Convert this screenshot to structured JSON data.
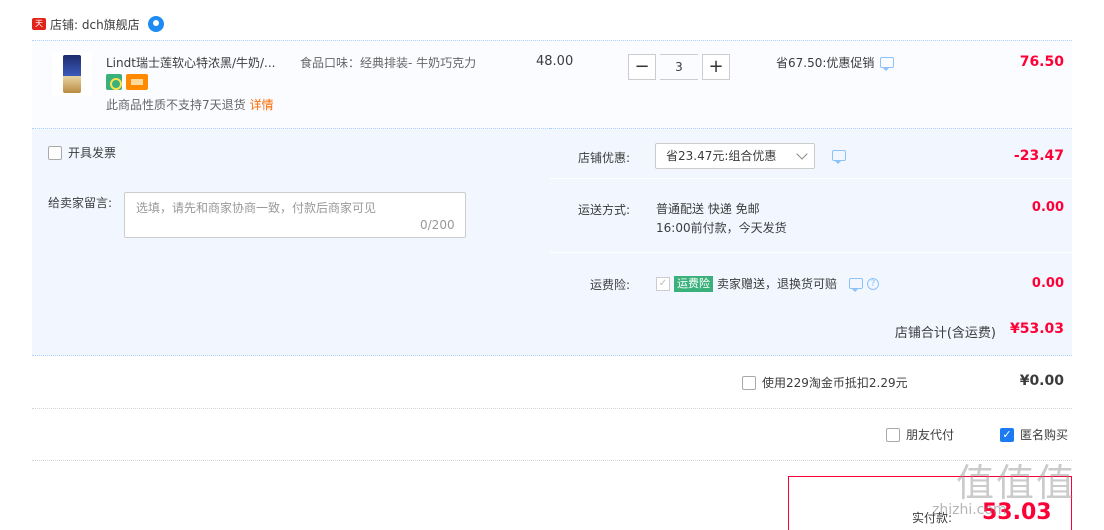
{
  "shop": {
    "badge": "天猫",
    "name": "店铺: dch旗舰店"
  },
  "item": {
    "title": "Lindt瑞士莲软心特浓黑/牛奶/...",
    "sku": "食品口味：经典排装- 牛奶巧克力",
    "unit_price": "48.00",
    "quantity": "3",
    "saving": "省67.50:优惠促销",
    "total": "76.50",
    "returns_text": "此商品性质不支持7天退货",
    "returns_link": "详情"
  },
  "invoice": {
    "label": "开具发票"
  },
  "message": {
    "label": "给卖家留言:",
    "placeholder": "选填，请先和商家协商一致，付款后商家可见",
    "counter": "0/200"
  },
  "shop_discount": {
    "label": "店铺优惠:",
    "selected": "省23.47元:组合优惠",
    "amount": "-23.47"
  },
  "shipping": {
    "label": "运送方式:",
    "line1": "普通配送 快递 免邮",
    "line2": "16:00前付款，今天发货",
    "amount": "0.00"
  },
  "insurance": {
    "label": "运费险:",
    "tag": "运费险",
    "text": "卖家赠送，退换货可赔",
    "amount": "0.00"
  },
  "subtotal": {
    "label": "店铺合计(含运费)",
    "value": "¥53.03"
  },
  "coins": {
    "label": "使用229淘金币抵扣2.29元",
    "value": "¥0.00"
  },
  "options": {
    "friend_pay": "朋友代付",
    "anonymous": "匿名购买"
  },
  "payment": {
    "label": "实付款:",
    "value": "53.03"
  },
  "watermark": {
    "text": "值值值",
    "domain": "zhizhi.com"
  }
}
